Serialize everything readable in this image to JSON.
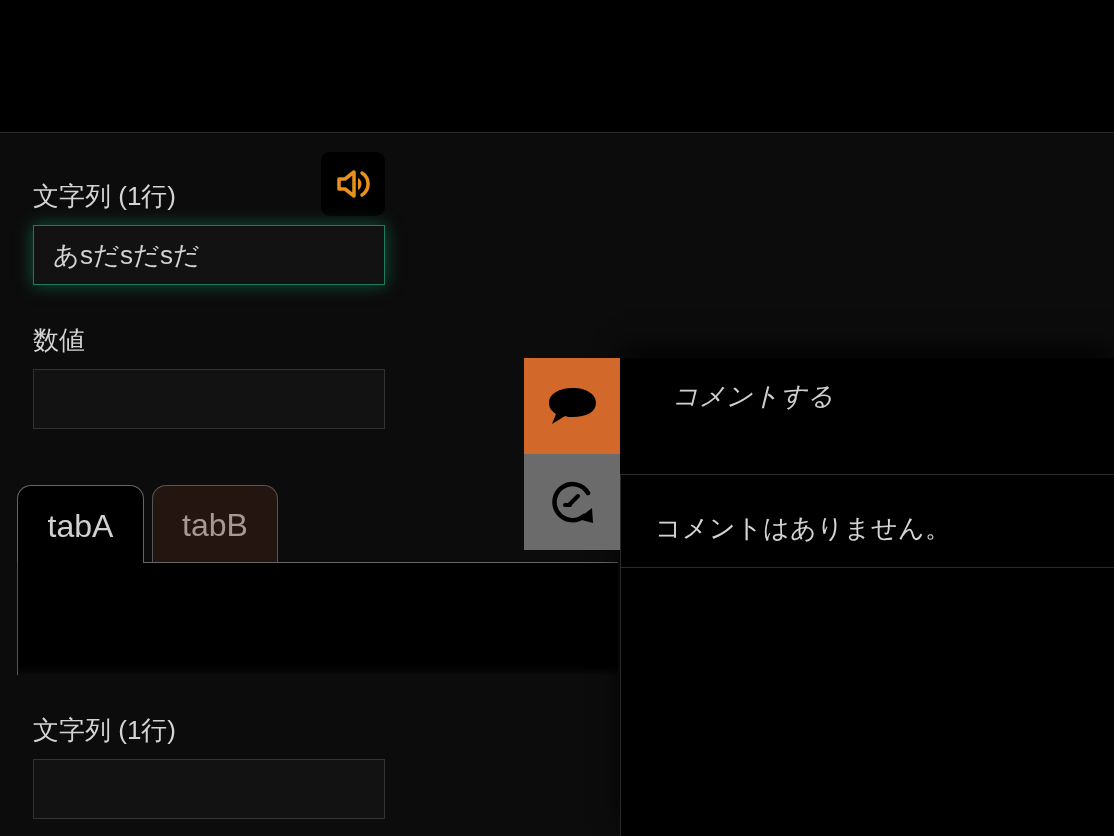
{
  "fields_top": [
    {
      "label": "文字列 (1行)",
      "value": "あsだsだsだ",
      "focused": true,
      "speech_button": true
    },
    {
      "label": "数値",
      "focused": false
    }
  ],
  "tabs": [
    {
      "label": "tabA",
      "selected": true
    },
    {
      "label": "tabB",
      "selected": false
    }
  ],
  "fields_bottom": [
    {
      "label": "文字列 (1行)",
      "focused": false
    }
  ],
  "comments": {
    "side_buttons": [
      {
        "kind": "comment",
        "selected": true
      },
      {
        "kind": "history",
        "selected": false
      }
    ],
    "input": {
      "placeholder": "コメントする"
    },
    "empty_message": "コメントはありません。"
  }
}
